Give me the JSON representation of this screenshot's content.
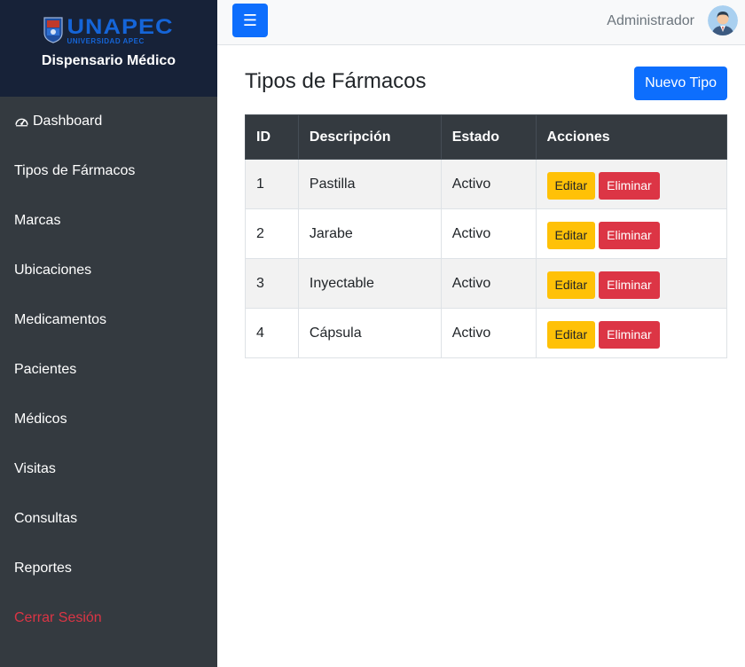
{
  "brand": {
    "logo_main": "UNAPEC",
    "logo_sub": "UNIVERSIDAD APEC",
    "title": "Dispensario Médico"
  },
  "sidebar": {
    "items": [
      {
        "label": "Dashboard",
        "icon": "dashboard-icon"
      },
      {
        "label": "Tipos de Fármacos"
      },
      {
        "label": "Marcas"
      },
      {
        "label": "Ubicaciones"
      },
      {
        "label": "Medicamentos"
      },
      {
        "label": "Pacientes"
      },
      {
        "label": "Médicos"
      },
      {
        "label": "Visitas"
      },
      {
        "label": "Consultas"
      },
      {
        "label": "Reportes"
      },
      {
        "label": "Cerrar Sesión"
      }
    ]
  },
  "topbar": {
    "menu_icon": "☰",
    "user_name": "Administrador",
    "avatar_icon": "user-avatar-icon"
  },
  "main": {
    "title": "Tipos de Fármacos",
    "new_button": "Nuevo Tipo",
    "table": {
      "headers": [
        "ID",
        "Descripción",
        "Estado",
        "Acciones"
      ],
      "rows": [
        {
          "id": "1",
          "descripcion": "Pastilla",
          "estado": "Activo",
          "edit": "Editar",
          "delete": "Eliminar"
        },
        {
          "id": "2",
          "descripcion": "Jarabe",
          "estado": "Activo",
          "edit": "Editar",
          "delete": "Eliminar"
        },
        {
          "id": "3",
          "descripcion": "Inyectable",
          "estado": "Activo",
          "edit": "Editar",
          "delete": "Eliminar"
        },
        {
          "id": "4",
          "descripcion": "Cápsula",
          "estado": "Activo",
          "edit": "Editar",
          "delete": "Eliminar"
        }
      ]
    }
  },
  "colors": {
    "primary": "#0d6efd",
    "sidebar": "#343a40",
    "brand_bg": "#172238",
    "warning": "#ffc107",
    "danger": "#dc3545"
  }
}
